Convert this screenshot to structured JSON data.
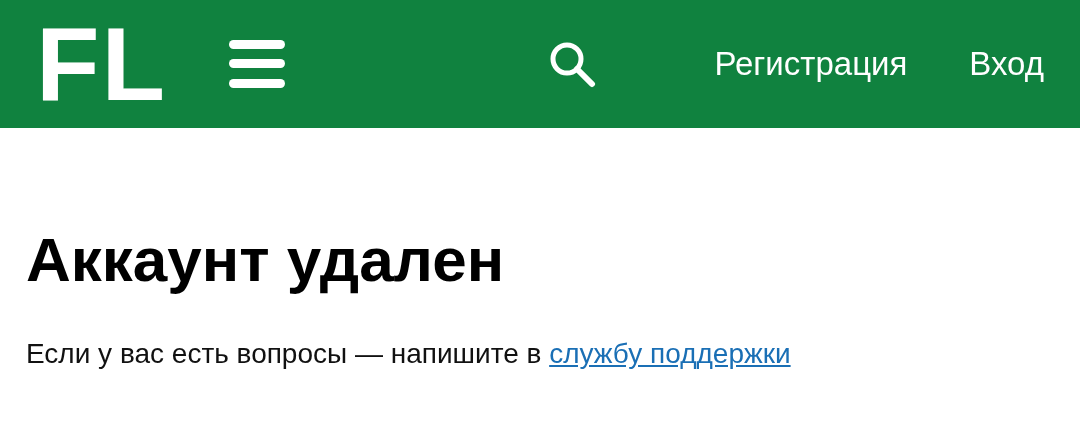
{
  "header": {
    "logo": "FL",
    "links": [
      {
        "label": "Регистрация"
      },
      {
        "label": "Вход"
      }
    ]
  },
  "heading": "Аккаунт удален",
  "message": {
    "text": "Если у вас есть вопросы — напишите в",
    "link": "службу поддержки"
  }
}
